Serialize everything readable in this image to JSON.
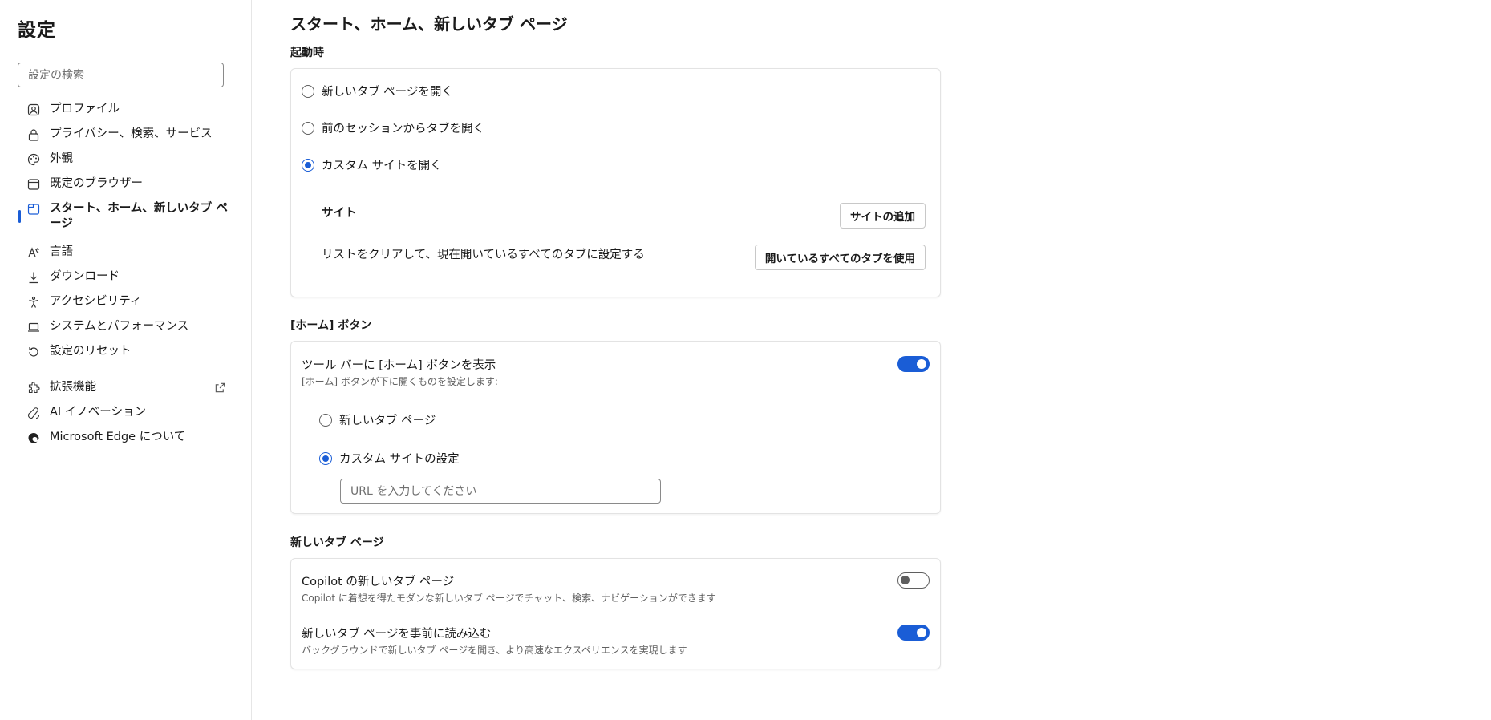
{
  "sidebar": {
    "title": "設定",
    "search_placeholder": "設定の検索",
    "items": [
      {
        "label": "プロファイル",
        "icon": "profile-icon"
      },
      {
        "label": "プライバシー、検索、サービス",
        "icon": "lock-icon"
      },
      {
        "label": "外観",
        "icon": "appearance-icon"
      },
      {
        "label": "既定のブラウザー",
        "icon": "browser-icon"
      },
      {
        "label": "スタート、ホーム、新しいタブ ページ",
        "icon": "start-home-icon",
        "active": true
      },
      {
        "label": "言語",
        "icon": "language-icon"
      },
      {
        "label": "ダウンロード",
        "icon": "download-icon"
      },
      {
        "label": "アクセシビリティ",
        "icon": "accessibility-icon"
      },
      {
        "label": "システムとパフォーマンス",
        "icon": "laptop-icon"
      },
      {
        "label": "設定のリセット",
        "icon": "reset-icon"
      },
      {
        "label": "拡張機能",
        "icon": "extensions-icon"
      },
      {
        "label": "AI イノベーション",
        "icon": "ai-icon"
      },
      {
        "label": "Microsoft Edge について",
        "icon": "edge-icon"
      }
    ]
  },
  "main": {
    "title": "スタート、ホーム、新しいタブ ページ",
    "startup": {
      "label": "起動時",
      "options": [
        {
          "label": "新しいタブ ページを開く",
          "checked": false
        },
        {
          "label": "前のセッションからタブを開く",
          "checked": false
        },
        {
          "label": "カスタム サイトを開く",
          "checked": true
        }
      ],
      "sites_label": "サイト",
      "add_site_button": "サイトの追加",
      "clear_list_text": "リストをクリアして、現在開いているすべてのタブに設定する",
      "use_all_tabs_button": "開いているすべてのタブを使用"
    },
    "home_button": {
      "label": "[ホーム] ボタン",
      "show_label": "ツール バーに [ホーム] ボタンを表示",
      "show_sub": "[ホーム] ボタンが下に開くものを設定します:",
      "show_on": true,
      "options": [
        {
          "label": "新しいタブ ページ",
          "checked": false
        },
        {
          "label": "カスタム サイトの設定",
          "checked": true
        }
      ],
      "url_placeholder": "URL を入力してください"
    },
    "new_tab": {
      "label": "新しいタブ ページ",
      "copilot_label": "Copilot の新しいタブ ページ",
      "copilot_sub": "Copilot に着想を得たモダンな新しいタブ ページでチャット、検索、ナビゲーションができます",
      "copilot_on": false,
      "preload_label": "新しいタブ ページを事前に読み込む",
      "preload_sub": "バックグラウンドで新しいタブ ページを開き、より高速なエクスペリエンスを実現します",
      "preload_on": true
    }
  },
  "colors": {
    "accent": "#1a5dd6",
    "border": "#e3e3e3"
  }
}
